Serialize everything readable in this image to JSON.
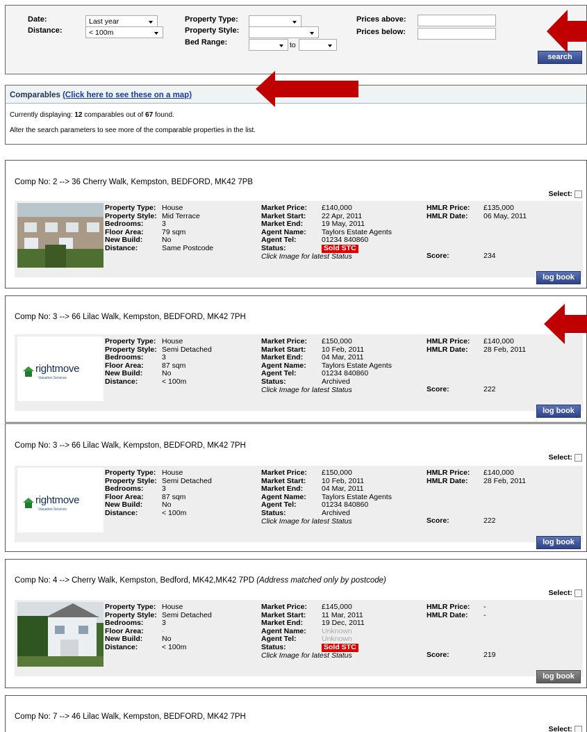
{
  "search": {
    "date_label": "Date:",
    "date_value": "Last year",
    "distance_label": "Distance:",
    "distance_value": "< 100m",
    "property_type_label": "Property Type:",
    "property_style_label": "Property Style:",
    "bed_range_label": "Bed Range:",
    "bed_to": "to",
    "prices_above_label": "Prices above:",
    "prices_below_label": "Prices below:",
    "search_button": "search"
  },
  "comparables": {
    "title": "Comparables",
    "map_link": "(Click here to see these on a map)",
    "currently_prefix": "Currently displaying: ",
    "displayed_count": "12",
    "mid_text": " comparables out of ",
    "total_count": "67",
    "found_suffix": " found.",
    "alter_text": "Alter the search parameters to see more of the comparable properties in the list."
  },
  "labels": {
    "property_type": "Property Type:",
    "property_style": "Property Style:",
    "bedrooms": "Bedrooms:",
    "floor_area": "Floor Area:",
    "new_build": "New Build:",
    "distance": "Distance:",
    "market_price": "Market Price:",
    "market_start": "Market Start:",
    "market_end": "Market End:",
    "agent_name": "Agent Name:",
    "agent_tel": "Agent Tel:",
    "status": "Status:",
    "click_image": "Click Image for latest Status",
    "hmlr_price": "HMLR Price:",
    "hmlr_date": "HMLR Date:",
    "score": "Score:",
    "select": "Select:",
    "log_book": "log book",
    "rightmove": "rightmove",
    "rightmove_sub": "Valuation Services"
  },
  "comps": [
    {
      "title": "Comp No: 2 --> 36 Cherry Walk, Kempston, BEDFORD, MK42 7PB",
      "note": "",
      "property_type": "House",
      "property_style": "Mid Terrace",
      "bedrooms": "3",
      "floor_area": "79 sqm",
      "new_build": "No",
      "distance": "Same Postcode",
      "market_price": "£140,000",
      "market_start": "22 Apr, 2011",
      "market_end": "19 May, 2011",
      "agent_name": "Taylors Estate Agents",
      "agent_tel": "01234 840860",
      "status": "Sold STC",
      "hmlr_price": "£135,000",
      "hmlr_date": "06 May, 2011",
      "score": "234"
    },
    {
      "title": "Comp No: 3 --> 66 Lilac Walk, Kempston, BEDFORD, MK42 7PH",
      "note": "",
      "property_type": "House",
      "property_style": "Semi Detached",
      "bedrooms": "3",
      "floor_area": "87 sqm",
      "new_build": "No",
      "distance": "< 100m",
      "market_price": "£150,000",
      "market_start": "10 Feb, 2011",
      "market_end": "04 Mar, 2011",
      "agent_name": "Taylors Estate Agents",
      "agent_tel": "01234 840860",
      "status": "Archived",
      "hmlr_price": "£140,000",
      "hmlr_date": "28 Feb, 2011",
      "score": "222"
    },
    {
      "title": "Comp No: 3 --> 66 Lilac Walk, Kempston, BEDFORD, MK42 7PH",
      "note": "",
      "property_type": "House",
      "property_style": "Semi Detached",
      "bedrooms": "3",
      "floor_area": "87 sqm",
      "new_build": "No",
      "distance": "< 100m",
      "market_price": "£150,000",
      "market_start": "10 Feb, 2011",
      "market_end": "04 Mar, 2011",
      "agent_name": "Taylors Estate Agents",
      "agent_tel": "01234 840860",
      "status": "Archived",
      "hmlr_price": "£140,000",
      "hmlr_date": "28 Feb, 2011",
      "score": "222"
    },
    {
      "title": "Comp No: 4 --> Cherry Walk, Kempston, Bedford, MK42,MK42 7PD ",
      "note": "(Address matched only by postcode)",
      "property_type": "House",
      "property_style": "Semi Detached",
      "bedrooms": "3",
      "floor_area": "-",
      "new_build": "No",
      "distance": "< 100m",
      "market_price": "£145,000",
      "market_start": "11 Mar, 2011",
      "market_end": "19 Dec, 2011",
      "agent_name": "Unknown",
      "agent_tel": "Unknown",
      "status": "Sold STC",
      "hmlr_price": "-",
      "hmlr_date": "-",
      "score": "219"
    },
    {
      "title": "Comp No: 7 --> 46 Lilac Walk, Kempston, BEDFORD, MK42 7PH",
      "note": ""
    }
  ],
  "colors": {
    "arrow": "#c00000",
    "button_blue": "#3b4f96",
    "status_red": "#e00000"
  }
}
